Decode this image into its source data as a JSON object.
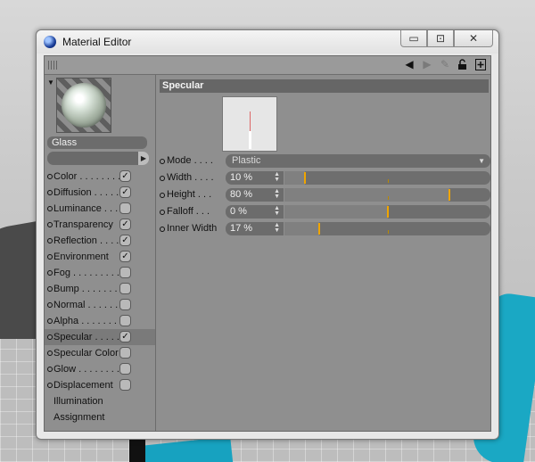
{
  "window": {
    "title": "Material Editor",
    "controls": {
      "minimize": "▭",
      "maximize": "⊡",
      "close": "✕"
    }
  },
  "toolbar": {
    "icons": [
      "back-arrow-icon",
      "forward-arrow-icon",
      "pin-icon",
      "unlock-icon",
      "new-window-icon"
    ]
  },
  "material": {
    "name": "Glass"
  },
  "channels": [
    {
      "label": "Color . . . . . . . .",
      "checked": true,
      "dot": true
    },
    {
      "label": "Diffusion . . . . . .",
      "checked": true,
      "dot": true
    },
    {
      "label": "Luminance . . . . .",
      "checked": false,
      "dot": true
    },
    {
      "label": "Transparency",
      "checked": true,
      "dot": true
    },
    {
      "label": "Reflection . . . .",
      "checked": true,
      "dot": true
    },
    {
      "label": "Environment",
      "checked": true,
      "dot": true
    },
    {
      "label": "Fog . . . . . . . . .",
      "checked": false,
      "dot": true
    },
    {
      "label": "Bump . . . . . . . .",
      "checked": false,
      "dot": true
    },
    {
      "label": "Normal . . . . . . .",
      "checked": false,
      "dot": true
    },
    {
      "label": "Alpha . . . . . . . .",
      "checked": false,
      "dot": true
    },
    {
      "label": "Specular . . . . . .",
      "checked": true,
      "dot": true,
      "selected": true
    },
    {
      "label": "Specular Color",
      "checked": false,
      "dot": true
    },
    {
      "label": "Glow . . . . . . . .",
      "checked": false,
      "dot": true
    },
    {
      "label": "Displacement",
      "checked": false,
      "dot": true
    },
    {
      "label": "Illumination",
      "checked": null,
      "dot": false
    },
    {
      "label": "Assignment",
      "checked": null,
      "dot": false
    }
  ],
  "specular": {
    "section_title": "Specular",
    "mode": {
      "label": "Mode . . . .",
      "value": "Plastic"
    },
    "params": [
      {
        "label": "Width . . . .",
        "value": "10 %",
        "percent": 10
      },
      {
        "label": "Height . . .",
        "value": "80 %",
        "percent": 80
      },
      {
        "label": "Falloff . . .",
        "value": "0 %",
        "percent": 50
      },
      {
        "label": "Inner Width",
        "value": "17 %",
        "percent": 17
      }
    ]
  }
}
